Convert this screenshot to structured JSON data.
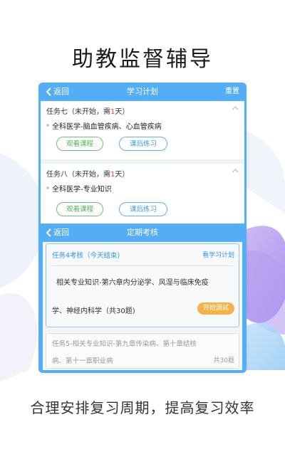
{
  "headline": "助教监督辅导",
  "footline": "合理安排复习周期，提高复习效率",
  "plan_screen": {
    "back_label": "返回",
    "title": "学习计划",
    "reset_label": "重置",
    "tasks": [
      {
        "name_prefix": "任务七（未开始，需",
        "days": "1",
        "name_suffix": "天）",
        "course": "全科医学-脑血管疾病、心血管疾病",
        "watch_label": "观看课程",
        "practice_label": "课后练习"
      },
      {
        "name_prefix": "任务八（未开始，需",
        "days": "1",
        "name_suffix": "天）",
        "course": "全科医学-专业知识",
        "watch_label": "观看课程",
        "practice_label": "课后练习"
      }
    ]
  },
  "exam_screen": {
    "back_label": "返回",
    "title": "定期考核",
    "exams": [
      {
        "title": "任务4考核（今天结束)",
        "link": "看学习计划",
        "desc_line1": "相关专业知识-第六章内分泌学、风湿与临床免疫",
        "desc_line2": "学、神经内科学（共30题)",
        "start_label": "开始测试"
      },
      {
        "desc_line1": "任务5-相关专业知识-第九章传染病、第十章结核",
        "desc_line2": "病、第十一章职业病",
        "count": "共30题"
      }
    ]
  },
  "colors": {
    "accent_blue": "#53aef5",
    "green": "#4db552",
    "orange": "#f6b24a",
    "red": "#e8452f"
  }
}
